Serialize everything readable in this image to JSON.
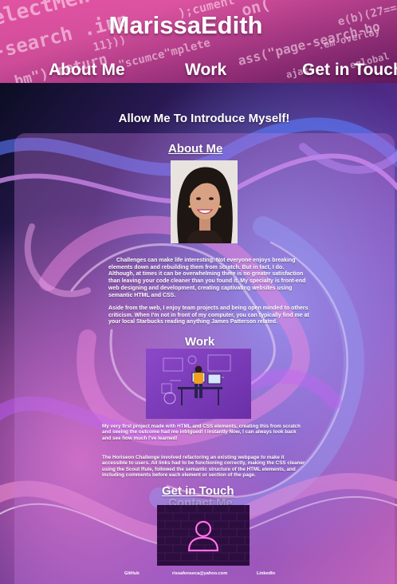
{
  "header": {
    "title": "MarissaEdith",
    "nav": {
      "about": "About Me",
      "work": "Work",
      "contact": "Get in Touch"
    }
  },
  "intro": "Allow Me To Introduce Myself!",
  "about": {
    "heading": "About Me",
    "paragraph1": "Challenges can make life interesting. Not everyone enjoys breaking elements down and rebuilding them from scratch. But in fact, I do. Although, at times it can be overwhelming there is no greater satisfaction than leaving your code cleaner than you found it. My specialty is front-end web designing and development, creating captivating websites using semantic HTML and CSS.",
    "paragraph2": "Aside from the web, I enjoy team projects and being open minded to others criticism. When I'm not in front of my computer, you can typically find me at your local Starbucks reading anything James Patterson related."
  },
  "work": {
    "heading": "Work",
    "paragraph1": "My very first project made with HTML and CSS elements, creating this from scratch and seeing the outcome had me intrigued! I instantly Now, I can always look back and see how much I've learned!",
    "paragraph2": "The Horiseon Challenge involved refactoring an existing webpage to make it accessible to users. All links had to be functioning correctly, making the CSS cleaner using the Scout Rule, followed the semantic structure of the HTML elements, and including comments before each element or section of the page."
  },
  "contact": {
    "heading": "Get in Touch",
    "ghost_heading": "Contact Me"
  },
  "footer": {
    "github": "GitHub",
    "email": "rissafonseca@yahoo.com",
    "linkedin": "LinkedIn"
  },
  "header_code_text": [
    "electMen",
    "-search .inp",
    "bm\") return",
    ");cument",
    "\"scumce\"mplete",
    "ass(\"page-search-bo",
    "on(",
    ".em-overlay",
    "e(b)(27==e",
    "ajax(",
    "11}))",
    "eglobal"
  ],
  "colors": {
    "panel": "#c478dc",
    "header_pink": "#e0509f",
    "bg_dark": "#0e1024"
  }
}
